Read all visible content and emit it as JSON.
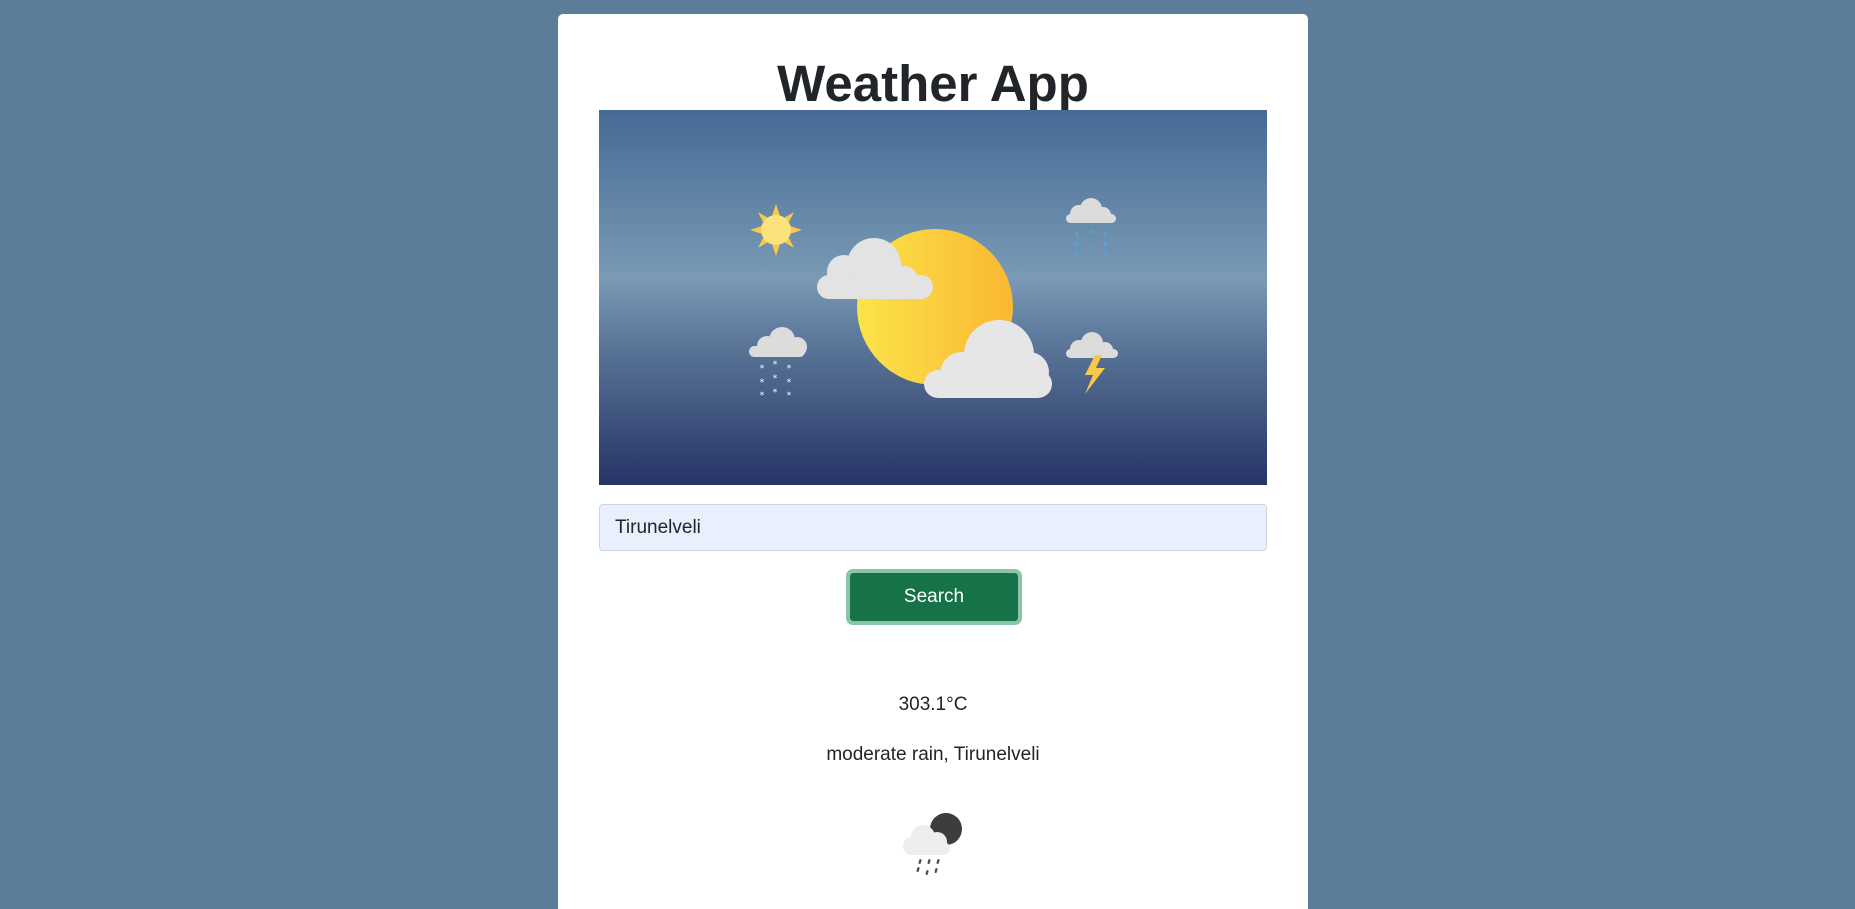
{
  "app": {
    "title": "Weather App"
  },
  "search": {
    "value": "Tirunelveli",
    "button_label": "Search"
  },
  "result": {
    "temperature": "303.1°C",
    "description": "moderate rain, Tirunelveli",
    "icon": "night-rain-icon"
  },
  "colors": {
    "page_background": "#5b7d99",
    "card_background": "#ffffff",
    "button_background": "#157347",
    "button_focus_ring": "#8cc4a6",
    "input_background": "#e8f0fe"
  }
}
